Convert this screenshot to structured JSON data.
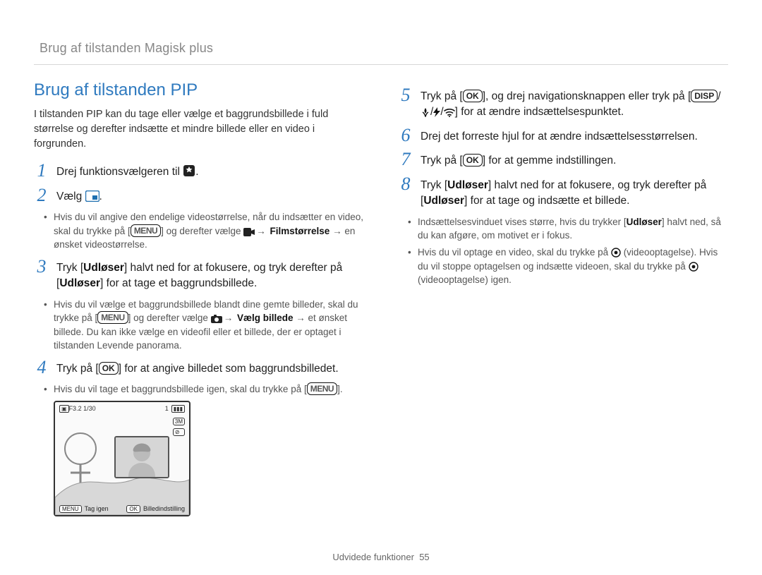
{
  "running_head": "Brug af tilstanden Magisk plus",
  "section_title": "Brug af tilstanden PIP",
  "intro": "I tilstanden PIP kan du tage eller vælge et baggrundsbillede i fuld størrelse og derefter indsætte et mindre billede eller en video i forgrunden.",
  "labels": {
    "ok": "OK",
    "menu": "MENU",
    "disp": "DISP",
    "udloser": "Udløser",
    "filmstorrelse": "Filmstørrelse",
    "vaelg_billede": "Vælg billede"
  },
  "steps": {
    "s1": "Drej funktionsvælgeren til",
    "s1_end": ".",
    "s2": "Vælg",
    "s2_end": ".",
    "s2_sub_a_pre": "Hvis du vil angive den endelige videostørrelse, når du indsætter en video, skal du trykke på [",
    "s2_sub_a_mid": "] og derefter vælge",
    "s2_sub_a_post": " → en ønsket videostørrelse.",
    "s3_pre": "Tryk [",
    "s3_mid": "] halvt ned for at fokusere, og tryk derefter på [",
    "s3_post": "] for at tage et baggrundsbillede.",
    "s3_sub_pre": "Hvis du vil vælge et baggrundsbillede blandt dine gemte billeder, skal du trykke på [",
    "s3_sub_mid": "] og derefter vælge",
    "s3_sub_post": " → et ønsket billede. Du kan ikke vælge en videofil eller et billede, der er optaget i tilstanden Levende panorama.",
    "s4_pre": "Tryk på [",
    "s4_post": "] for at angive billedet som baggrundsbilledet.",
    "s4_sub_pre": "Hvis du vil tage et baggrundsbillede igen, skal du trykke på [",
    "s4_sub_post": "].",
    "s5_pre": "Tryk på [",
    "s5_mid": "], og drej navigationsknappen eller tryk på [",
    "s5_post": "] for at ændre indsættelsespunktet.",
    "s6": "Drej det forreste hjul for at ændre indsættelsesstørrelsen.",
    "s7_pre": "Tryk på [",
    "s7_post": "] for at gemme indstillingen.",
    "s8_pre": "Tryk [",
    "s8_mid": "] halvt ned for at fokusere, og tryk derefter på [",
    "s8_post": "] for at tage og indsætte et billede.",
    "s8_sub_a_pre": "Indsættelsesvinduet vises større, hvis du trykker [",
    "s8_sub_a_post": "] halvt ned, så du kan afgøre, om motivet er i fokus.",
    "s8_sub_b_pre": "Hvis du vil optage en video, skal du trykke på",
    "s8_sub_b_mid": "(videooptagelse). Hvis du vil stoppe optagelsen og indsætte videoen, skal du trykke på",
    "s8_sub_b_post": "(videooptagelse) igen."
  },
  "preview": {
    "topbar_left": "F3.2 1/30",
    "topbar_right": "1",
    "size_badge": "3M",
    "tag_again_label": "Tag igen",
    "tag_again_chip": "MENU",
    "image_setting_label": "Billedindstilling",
    "image_setting_chip": "OK"
  },
  "footer_label": "Udvidede funktioner",
  "page_number": "55"
}
